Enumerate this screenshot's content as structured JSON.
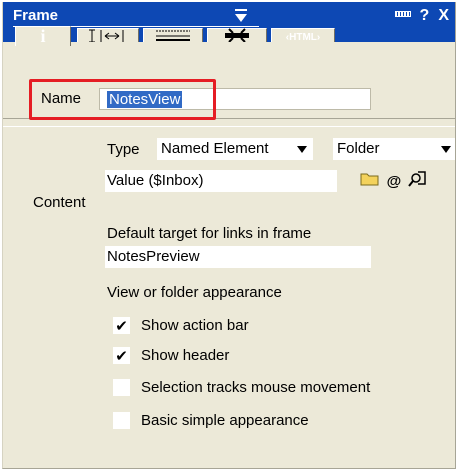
{
  "title_bar": {
    "title": "Frame",
    "help_label": "?",
    "close_label": "X"
  },
  "tabs": [
    {
      "label": "i",
      "icon": "info-icon",
      "active": true
    },
    {
      "label": "",
      "icon": "size-icon"
    },
    {
      "label": "",
      "icon": "border-lines-icon"
    },
    {
      "label": "",
      "icon": "frameset-icon"
    },
    {
      "label": "‹HTML›",
      "icon": "html-icon"
    }
  ],
  "name_section": {
    "label": "Name",
    "value": "NotesView"
  },
  "content_section": {
    "label": "Content",
    "type_label": "Type",
    "type_value": "Named Element",
    "element_kind_value": "Folder",
    "value_label": "Value",
    "value_text": "($Inbox)",
    "icons": [
      "folder-icon",
      "at-formula-icon",
      "lookup-icon"
    ],
    "target_label": "Default target for links in frame",
    "target_value": "NotesPreview",
    "appearance_label": "View or folder appearance",
    "options": [
      {
        "label": "Show action bar",
        "checked": true
      },
      {
        "label": "Show header",
        "checked": true
      },
      {
        "label": "Selection tracks mouse movement",
        "checked": false
      },
      {
        "label": "Basic simple appearance",
        "checked": false
      }
    ]
  },
  "colors": {
    "titlebar": "#0d48b4",
    "panel": "#ece9d8",
    "highlight_box": "#e51d24",
    "selection": "#316ac5"
  }
}
